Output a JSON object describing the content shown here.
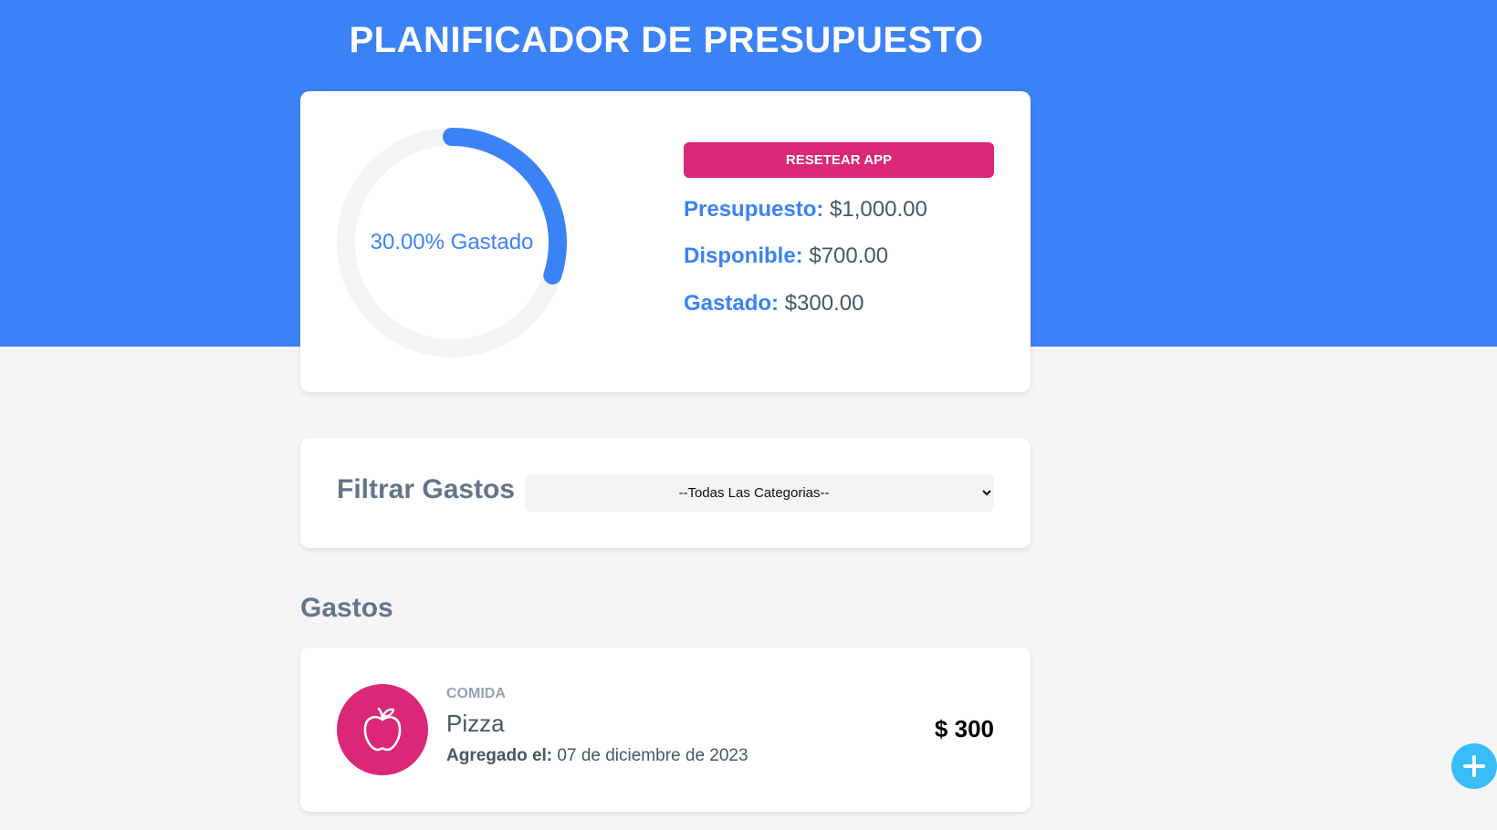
{
  "header": {
    "title": "PLANIFICADOR DE PRESUPUESTO",
    "accent_color": "#3b82f6"
  },
  "budget": {
    "spent_fraction": 0.3,
    "gauge_text": "30.00% Gastado",
    "reset_label": "RESETEAR APP",
    "budget_label": "Presupuesto:",
    "budget_value": "$1,000.00",
    "available_label": "Disponible:",
    "available_value": "$700.00",
    "spent_label": "Gastado:",
    "spent_value": "$300.00"
  },
  "filter": {
    "label": "Filtrar Gastos",
    "selected": "--Todas Las Categorias--"
  },
  "expenses": {
    "title": "Gastos",
    "items": [
      {
        "category": "COMIDA",
        "icon": "apple-icon",
        "name": "Pizza",
        "date_label": "Agregado el:",
        "date_value": "07 de diciembre de 2023",
        "amount": "$ 300"
      }
    ]
  },
  "fab": {
    "icon": "plus-icon",
    "color": "#38bdf8"
  },
  "colors": {
    "brand_pink": "#db2777",
    "background": "#f5f5f5"
  }
}
